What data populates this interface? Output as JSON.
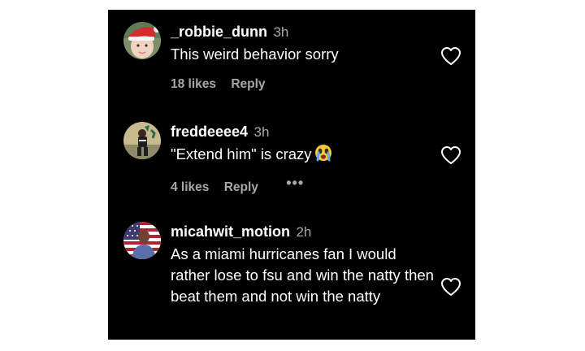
{
  "comments": [
    {
      "username": "_robbie_dunn",
      "timestamp": "3h",
      "text": "This weird behavior sorry",
      "likes": "18 likes",
      "reply": "Reply",
      "avatar_icon": "avatar-baby-santa-hat"
    },
    {
      "username": "freddeeee4",
      "timestamp": "3h",
      "text": "\"Extend him\" is crazy",
      "emoji": "crying-face-icon",
      "likes": "4 likes",
      "reply": "Reply",
      "more": "•••",
      "avatar_icon": "avatar-football-player"
    },
    {
      "username": "micahwit_motion",
      "timestamp": "2h",
      "text": "As a miami hurricanes fan I would rather lose to fsu and win the natty then beat them and not win the natty",
      "avatar_icon": "avatar-us-flag-person"
    }
  ],
  "colors": {
    "background": "#000000",
    "primary_text": "#ffffff",
    "secondary_text": "#a8a8a8"
  }
}
